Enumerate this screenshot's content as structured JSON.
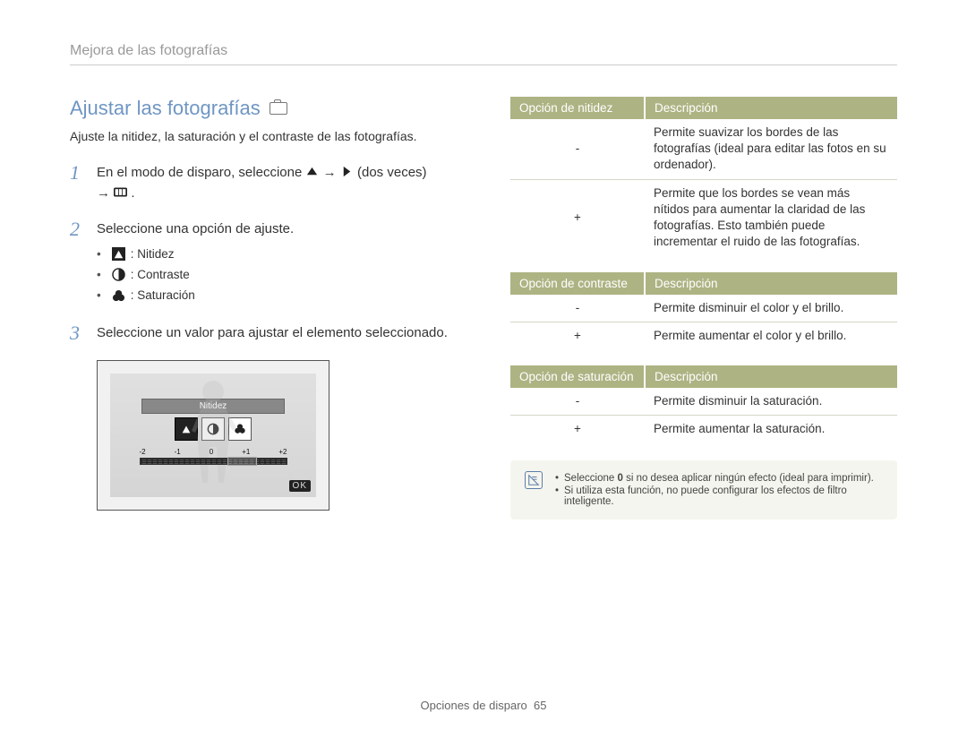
{
  "breadcrumb": "Mejora de las fotografías",
  "section_title": "Ajustar las fotografías",
  "subtitle": "Ajuste la nitidez, la saturación y el contraste de las fotografías.",
  "steps": [
    {
      "num": "1",
      "text_before": "En el modo de disparo, seleccione ",
      "text_mid": " (dos veces) ",
      "text_after": "."
    },
    {
      "num": "2",
      "text": "Seleccione una opción de ajuste.",
      "bullets": [
        {
          "icon": "sharpness",
          "label": ": Nitidez"
        },
        {
          "icon": "contrast",
          "label": ": Contraste"
        },
        {
          "icon": "saturation",
          "label": ": Saturación"
        }
      ]
    },
    {
      "num": "3",
      "text": "Seleccione un valor para ajustar el elemento seleccionado."
    }
  ],
  "display": {
    "label": "Nitidez",
    "scale": [
      "-2",
      "-1",
      "0",
      "+1",
      "+2"
    ],
    "ok": "OK"
  },
  "tables": [
    {
      "head": [
        "Opción de nitidez",
        "Descripción"
      ],
      "rows": [
        [
          "-",
          "Permite suavizar los bordes de las fotografías (ideal para editar las fotos en su ordenador)."
        ],
        [
          "+",
          "Permite que los bordes se vean más nítidos para aumentar la claridad de las fotografías. Esto también puede incrementar el ruido de las fotografías."
        ]
      ]
    },
    {
      "head": [
        "Opción de contraste",
        "Descripción"
      ],
      "rows": [
        [
          "-",
          "Permite disminuir el color y el brillo."
        ],
        [
          "+",
          "Permite aumentar el color y el brillo."
        ]
      ]
    },
    {
      "head": [
        "Opción de saturación",
        "Descripción"
      ],
      "rows": [
        [
          "-",
          "Permite disminuir la saturación."
        ],
        [
          "+",
          "Permite aumentar la saturación."
        ]
      ]
    }
  ],
  "notes": [
    {
      "pre": "Seleccione ",
      "bold": "0",
      "post": " si no desea aplicar ningún efecto (ideal para imprimir)."
    },
    {
      "pre": "Si utiliza esta función, no puede configurar los efectos de filtro inteligente.",
      "bold": "",
      "post": ""
    }
  ],
  "footer_label": "Opciones de disparo",
  "footer_page": "65"
}
